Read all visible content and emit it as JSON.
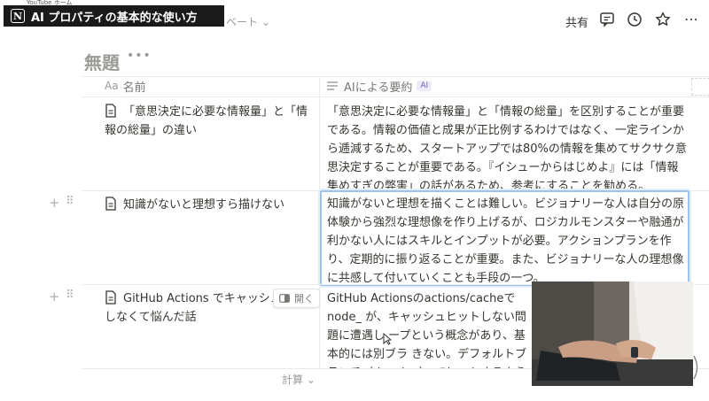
{
  "video": {
    "top_tag": "YouTube ホーム",
    "banner_title": "AI プロパティの基本的な使い方",
    "logo_letter": "N"
  },
  "topbar": {
    "breadcrumb": "ベート",
    "share_label": "共有"
  },
  "page": {
    "title": "無題",
    "more": "•••"
  },
  "table": {
    "columns": [
      {
        "icon": "Aa",
        "label": "名前"
      },
      {
        "label": "AIによる要約",
        "badge": "AI"
      }
    ],
    "rows": [
      {
        "name": "「意思決定に必要な情報量」と「情報の総量」の違い",
        "summary": "「意思決定に必要な情報量」と「情報の総量」を区別することが重要である。情報の価値と成果が正比例するわけではなく、一定ラインから逓減するため、スタートアップでは80%の情報を集めてサクサク意思決定することが重要である。『イシューからはじめよ』には「情報集めすぎの弊害」の話があるため、参考にすることを勧める。"
      },
      {
        "name": "知識がないと理想すら描けない",
        "summary": "知識がないと理想を描くことは難しい。ビジョナリーな人は自分の原体験から強烈な理想像を作り上げるが、ロジカルモンスターや融通が利かない人にはスキルとインプットが必要。アクションプランを作り、定期的に振り返ることが重要。また、ビジョナリーな人の理想像に共感して付いていくことも手段の一つ。"
      },
      {
        "name": "GitHub Actions でキャッシュ しなくて悩んだ話",
        "summary": "GitHub Actionsのactions/cacheでnode_ が、キャッシュヒットしない問題に遭遇し ープという概念があり、基本的には別ブラ きない。デフォルトブランチ（develop） でヒットするようになった。ただし、細か"
      }
    ],
    "open_label": "開く",
    "calc_label": "計算"
  }
}
